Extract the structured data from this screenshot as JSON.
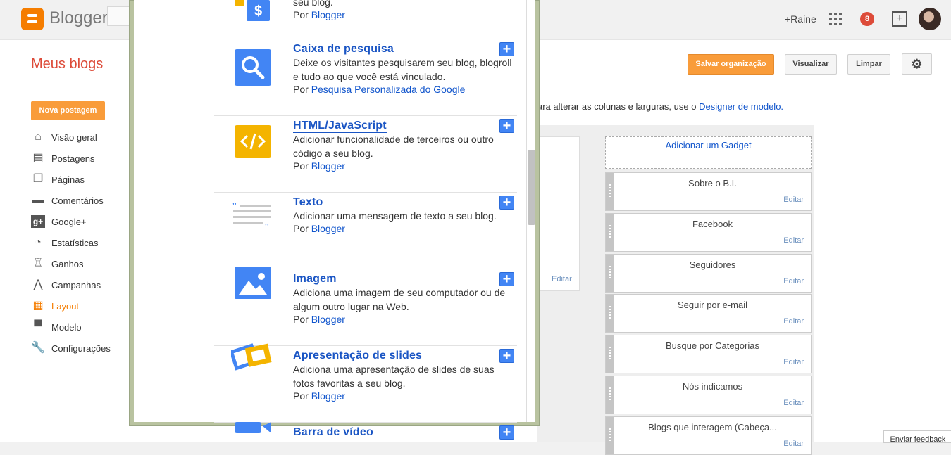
{
  "topbar": {
    "logo": "Blogger",
    "user_name": "+Raine",
    "notifications_count": "8"
  },
  "header": {
    "title": "Meus blogs",
    "save_label": "Salvar organização",
    "preview_label": "Visualizar",
    "clear_label": "Limpar"
  },
  "sidebar": {
    "new_post": "Nova postagem",
    "items": [
      {
        "label": "Visão geral",
        "icon": "home-icon"
      },
      {
        "label": "Postagens",
        "icon": "posts-icon"
      },
      {
        "label": "Páginas",
        "icon": "pages-icon"
      },
      {
        "label": "Comentários",
        "icon": "comments-icon"
      },
      {
        "label": "Google+",
        "icon": "google-plus-icon"
      },
      {
        "label": "Estatísticas",
        "icon": "stats-icon"
      },
      {
        "label": "Ganhos",
        "icon": "trophy-icon"
      },
      {
        "label": "Campanhas",
        "icon": "campaigns-icon"
      },
      {
        "label": "Layout",
        "icon": "layout-icon"
      },
      {
        "label": "Modelo",
        "icon": "paint-roller-icon"
      },
      {
        "label": "Configurações",
        "icon": "wrench-icon"
      }
    ],
    "active_index": 8
  },
  "layout": {
    "hint_text": "ara alterar as colunas e larguras, use o ",
    "hint_link": "Designer de modelo.",
    "col_edit": "Editar",
    "add_gadget": "Adicionar um Gadget",
    "widgets": [
      {
        "title": "Sobre o B.I.",
        "edit": "Editar"
      },
      {
        "title": "Facebook",
        "edit": "Editar"
      },
      {
        "title": "Seguidores",
        "edit": "Editar"
      },
      {
        "title": "Seguir por e-mail",
        "edit": "Editar"
      },
      {
        "title": "Busque por Categorias",
        "edit": "Editar"
      },
      {
        "title": "Nós indicamos",
        "edit": "Editar"
      },
      {
        "title": "Blogs que interagem (Cabeça...",
        "edit": "Editar"
      }
    ]
  },
  "feedback": "Enviar feedback",
  "dialog": {
    "by_label": "Por",
    "top_partial": {
      "desc": "seu blog.",
      "by": "Blogger"
    },
    "gadgets": [
      {
        "title": "Caixa de pesquisa",
        "desc": "Deixe os visitantes pesquisarem seu blog, blogroll e tudo ao que você está vinculado.",
        "by": "Pesquisa Personalizada do Google"
      },
      {
        "title": "HTML/JavaScript",
        "desc": "Adicionar funcionalidade de terceiros ou outro código a seu blog.",
        "by": "Blogger"
      },
      {
        "title": "Texto",
        "desc": "Adicionar uma mensagem de texto a seu blog.",
        "by": "Blogger"
      },
      {
        "title": "Imagem",
        "desc": "Adiciona uma imagem de seu computador ou de algum outro lugar na Web.",
        "by": "Blogger"
      },
      {
        "title": "Apresentação de slides",
        "desc": "Adiciona uma apresentação de slides de suas fotos favoritas a seu blog.",
        "by": "Blogger"
      },
      {
        "title": "Barra de vídeo",
        "desc": "",
        "by": ""
      }
    ]
  },
  "colors": {
    "accent_orange": "#f57d00",
    "link_blue": "#1a55c4",
    "add_button_blue": "#4285f4"
  }
}
